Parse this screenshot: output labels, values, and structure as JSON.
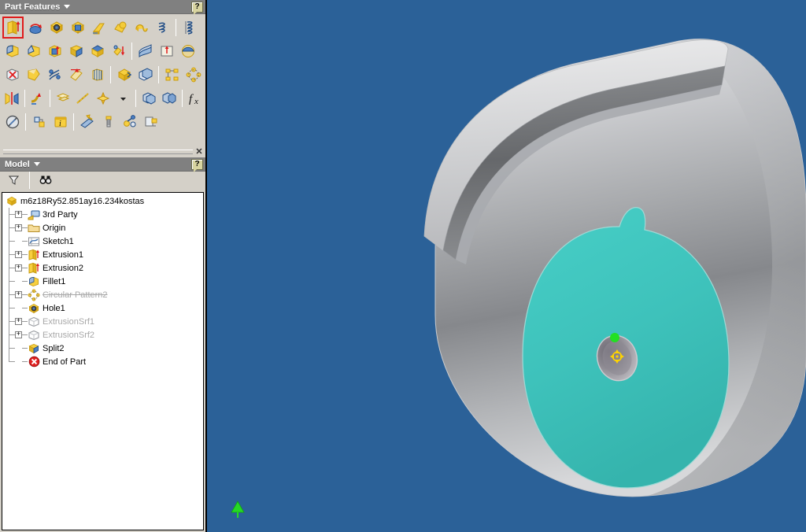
{
  "part_features_panel": {
    "title": "Part Features",
    "dropdown_icon": "caret-down-icon",
    "help_icon": "help-question-icon",
    "close_icon": "close-x-icon",
    "toolbar_rows": [
      {
        "items": [
          {
            "name": "extrude-icon",
            "label": "Extrude",
            "selected": true
          },
          {
            "name": "revolve-icon",
            "label": "Revolve",
            "selected": false
          },
          {
            "name": "hole-icon",
            "label": "Hole",
            "selected": false
          },
          {
            "name": "shell-icon",
            "label": "Shell",
            "selected": false
          },
          {
            "name": "rib-icon",
            "label": "Rib",
            "selected": false
          },
          {
            "name": "loft-icon",
            "label": "Loft",
            "selected": false
          },
          {
            "name": "sweep-icon",
            "label": "Sweep",
            "selected": false
          },
          {
            "name": "coil-icon",
            "label": "Coil",
            "selected": false
          },
          {
            "sep": true
          },
          {
            "name": "thread-icon",
            "label": "Thread",
            "selected": false
          }
        ]
      },
      {
        "items": [
          {
            "name": "fillet-icon",
            "label": "Fillet",
            "selected": false
          },
          {
            "name": "chamfer-icon",
            "label": "Chamfer",
            "selected": false
          },
          {
            "name": "face-draft-icon",
            "label": "Face Draft",
            "selected": false
          },
          {
            "name": "split-icon",
            "label": "Split",
            "selected": false
          },
          {
            "name": "thicken-offset-icon",
            "label": "Thicken/Offset",
            "selected": false
          },
          {
            "name": "direct-edit-icon",
            "label": "Direct Edit",
            "selected": false
          },
          {
            "sep": true
          },
          {
            "name": "sculpt-icon",
            "label": "Sculpt",
            "selected": false
          },
          {
            "name": "emboss-icon",
            "label": "Emboss",
            "selected": false
          },
          {
            "name": "decal-icon",
            "label": "Decal",
            "selected": false
          }
        ]
      },
      {
        "items": [
          {
            "name": "delete-face-icon",
            "label": "Delete Face",
            "selected": false
          },
          {
            "name": "patch-surface-icon",
            "label": "Patch",
            "selected": false
          },
          {
            "name": "stitch-icon",
            "label": "Stitch",
            "selected": false
          },
          {
            "name": "extend-surface-icon",
            "label": "Extend",
            "selected": false
          },
          {
            "name": "ruled-surface-icon",
            "label": "Ruled Surface",
            "selected": false
          },
          {
            "sep": true
          },
          {
            "name": "move-face-icon",
            "label": "Move Face",
            "selected": false
          },
          {
            "name": "copy-object-icon",
            "label": "Copy Object",
            "selected": false
          },
          {
            "sep": true
          },
          {
            "name": "rectangular-pattern-icon",
            "label": "Rectangular Pattern",
            "selected": false
          },
          {
            "name": "circular-pattern-icon",
            "label": "Circular Pattern",
            "selected": false
          }
        ]
      },
      {
        "items": [
          {
            "name": "mirror-icon",
            "label": "Mirror",
            "selected": false
          },
          {
            "sep": true
          },
          {
            "name": "bend-part-icon",
            "label": "Bend Part",
            "selected": false
          },
          {
            "sep": true
          },
          {
            "name": "work-plane-icon",
            "label": "Plane",
            "selected": false
          },
          {
            "name": "work-axis-icon",
            "label": "Axis",
            "selected": false
          },
          {
            "name": "work-point-icon",
            "label": "Point",
            "selected": false
          },
          {
            "name": "work-point-dropdown-icon",
            "label": "Point options",
            "selected": false
          },
          {
            "sep": true
          },
          {
            "name": "ucs-icon",
            "label": "UCS",
            "selected": false
          },
          {
            "name": "derive-icon",
            "label": "Derive",
            "selected": false
          },
          {
            "sep": true
          },
          {
            "name": "parameters-fx-icon",
            "label": "Parameters",
            "selected": false
          }
        ]
      },
      {
        "items": [
          {
            "name": "suppress-features-icon",
            "label": "Suppress Features",
            "selected": false
          },
          {
            "sep": true
          },
          {
            "name": "create-iparts-icon",
            "label": "Create iPart",
            "selected": false
          },
          {
            "name": "ifeature-icon",
            "label": "iFeature",
            "selected": false
          },
          {
            "sep": true
          },
          {
            "name": "stress-analysis-icon",
            "label": "Stress Analysis",
            "selected": false
          },
          {
            "name": "bolted-connection-icon",
            "label": "Bolted Connection",
            "selected": false
          },
          {
            "name": "insert-frame-icon",
            "label": "Frame Generator",
            "selected": false
          },
          {
            "name": "create-component-icon",
            "label": "Create Component",
            "selected": false
          }
        ]
      }
    ]
  },
  "model_panel": {
    "title": "Model",
    "dropdown_icon": "caret-down-icon",
    "help_icon": "help-question-icon",
    "tools": [
      {
        "name": "filter-icon",
        "label": "Filter"
      },
      {
        "name": "find-icon",
        "label": "Find"
      }
    ],
    "tree": [
      {
        "label": "m6z18Ry52.851ay16.234kostas",
        "icon": "part-document-icon",
        "depth": 0,
        "expand": "none",
        "state": "normal"
      },
      {
        "label": "3rd Party",
        "icon": "third-party-icon",
        "depth": 1,
        "expand": "plus",
        "state": "normal"
      },
      {
        "label": "Origin",
        "icon": "folder-icon",
        "depth": 1,
        "expand": "plus",
        "state": "normal"
      },
      {
        "label": "Sketch1",
        "icon": "sketch-icon",
        "depth": 1,
        "expand": "none",
        "state": "normal"
      },
      {
        "label": "Extrusion1",
        "icon": "extrusion-icon",
        "depth": 1,
        "expand": "plus",
        "state": "normal"
      },
      {
        "label": "Extrusion2",
        "icon": "extrusion-icon",
        "depth": 1,
        "expand": "plus",
        "state": "normal"
      },
      {
        "label": "Fillet1",
        "icon": "fillet-icon",
        "depth": 1,
        "expand": "none",
        "state": "normal"
      },
      {
        "label": "Circular Pattern2",
        "icon": "circular-pattern-icon",
        "depth": 1,
        "expand": "plus",
        "state": "suppressed"
      },
      {
        "label": "Hole1",
        "icon": "hole-icon",
        "depth": 1,
        "expand": "none",
        "state": "normal"
      },
      {
        "label": "ExtrusionSrf1",
        "icon": "surface-icon",
        "depth": 1,
        "expand": "plus",
        "state": "dimmed"
      },
      {
        "label": "ExtrusionSrf2",
        "icon": "surface-icon",
        "depth": 1,
        "expand": "plus",
        "state": "dimmed"
      },
      {
        "label": "Split2",
        "icon": "split-icon",
        "depth": 1,
        "expand": "none",
        "state": "normal"
      },
      {
        "label": "End of Part",
        "icon": "end-of-part-icon",
        "depth": 1,
        "expand": "none",
        "state": "normal"
      }
    ]
  },
  "viewport": {
    "name": "3d-graphics-window",
    "background_color": "#2b6198",
    "model": {
      "name": "cylindrical-part",
      "selected_face_color": "#3fc4bd",
      "body_color": "#b6b7ba",
      "highlight_marker": "green-vertex-marker",
      "center_marker": "yellow-move-marker",
      "origin_marker": "green-axis-triangle"
    }
  },
  "colors": {
    "panel_bg": "#d4d0c8",
    "title_bar": "#808080",
    "selection_outline": "#e01b1b",
    "viewport_bg": "#2b6198",
    "face_teal": "#3fc4bd",
    "metal_light": "#d9dadc",
    "metal_dark": "#6e7073"
  }
}
